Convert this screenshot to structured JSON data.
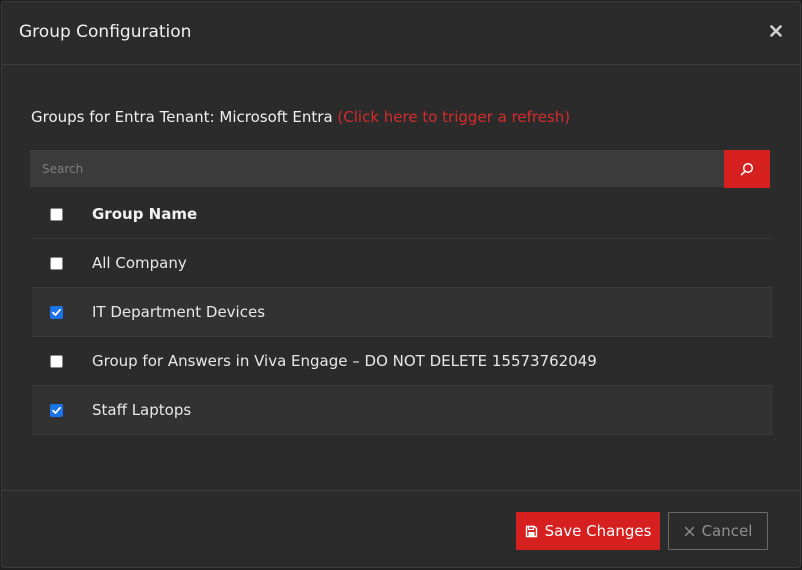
{
  "modal": {
    "title": "Group Configuration",
    "close_icon": "times-icon"
  },
  "tenant": {
    "prefix": "Groups for Entra Tenant: Microsoft Entra ",
    "refresh_link": "(Click here to trigger a refresh)"
  },
  "search": {
    "placeholder": "Search",
    "value": "",
    "button_icon": "search-icon"
  },
  "table": {
    "header": {
      "label": "Group Name",
      "checked": false
    },
    "rows": [
      {
        "label": "All Company",
        "checked": false
      },
      {
        "label": "IT Department Devices",
        "checked": true
      },
      {
        "label": "Group for Answers in Viva Engage – DO NOT DELETE 15573762049",
        "checked": false
      },
      {
        "label": "Staff Laptops",
        "checked": true
      }
    ]
  },
  "footer": {
    "save_label": "Save Changes",
    "save_icon": "floppy-disk-icon",
    "cancel_label": "Cancel",
    "cancel_icon": "times-icon"
  },
  "colors": {
    "accent": "#d61f1f",
    "checkbox_checked": "#1a73e8",
    "modal_bg": "#2b2b2b"
  }
}
